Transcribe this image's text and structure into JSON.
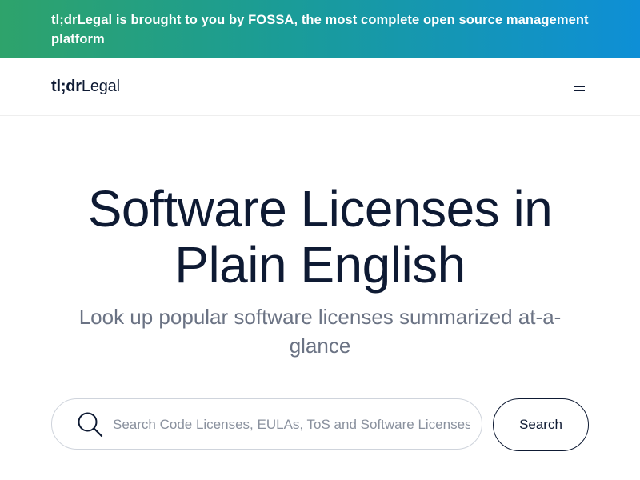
{
  "banner": {
    "text": "tl;drLegal is brought to you by FOSSA, the most complete open source management platform"
  },
  "navbar": {
    "logo_bold": "tl;dr",
    "logo_regular": "Legal",
    "menu_icon": "hamburger-menu-icon"
  },
  "hero": {
    "title_line1": "Software Licenses in",
    "title_line2": "Plain English",
    "subtitle_line1": "Look up popular software licenses summarized at-a-",
    "subtitle_line2": "glance"
  },
  "search": {
    "placeholder": "Search Code Licenses, EULAs, ToS and Software Licenses",
    "value": "",
    "icon": "search-icon",
    "button_label": "Search"
  },
  "colors": {
    "banner_gradient_start": "#2ea36b",
    "banner_gradient_end": "#0e8fd6",
    "text_dark": "#0e1a33",
    "text_muted": "#6b7384"
  }
}
